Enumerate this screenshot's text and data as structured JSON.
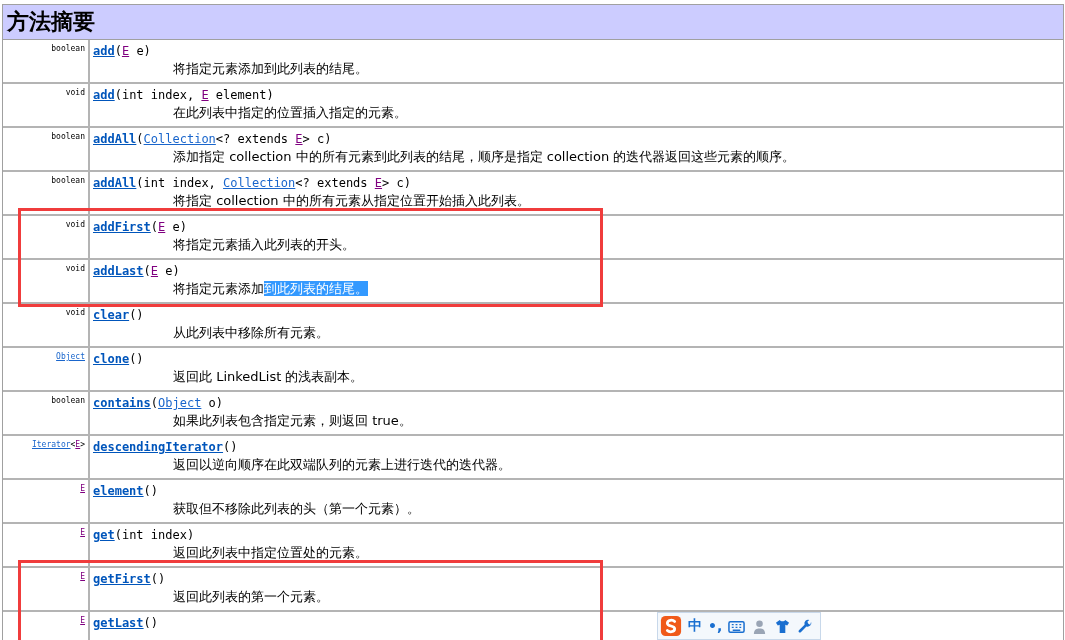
{
  "heading": "方法摘要",
  "rows": [
    {
      "return_type": [
        {
          "kind": "text",
          "text": "boolean"
        }
      ],
      "signature": [
        {
          "kind": "method",
          "text": "add"
        },
        {
          "kind": "text",
          "text": "("
        },
        {
          "kind": "type_param",
          "text": "E"
        },
        {
          "kind": "text",
          "text": " e)"
        }
      ],
      "description": "将指定元素添加到此列表的结尾。",
      "boxed": false
    },
    {
      "return_type": [
        {
          "kind": "text",
          "text": "void"
        }
      ],
      "signature": [
        {
          "kind": "method",
          "text": "add"
        },
        {
          "kind": "text",
          "text": "(int index, "
        },
        {
          "kind": "type_param",
          "text": "E"
        },
        {
          "kind": "text",
          "text": " element)"
        }
      ],
      "description": "在此列表中指定的位置插入指定的元素。",
      "boxed": false
    },
    {
      "return_type": [
        {
          "kind": "text",
          "text": "boolean"
        }
      ],
      "signature": [
        {
          "kind": "method",
          "text": "addAll"
        },
        {
          "kind": "text",
          "text": "("
        },
        {
          "kind": "type_link",
          "text": "Collection"
        },
        {
          "kind": "text",
          "text": "<? extends "
        },
        {
          "kind": "type_param",
          "text": "E"
        },
        {
          "kind": "text",
          "text": "> c)"
        }
      ],
      "description": "添加指定 collection 中的所有元素到此列表的结尾，顺序是指定 collection 的迭代器返回这些元素的顺序。",
      "boxed": false
    },
    {
      "return_type": [
        {
          "kind": "text",
          "text": "boolean"
        }
      ],
      "signature": [
        {
          "kind": "method",
          "text": "addAll"
        },
        {
          "kind": "text",
          "text": "(int index, "
        },
        {
          "kind": "type_link",
          "text": "Collection"
        },
        {
          "kind": "text",
          "text": "<? extends "
        },
        {
          "kind": "type_param",
          "text": "E"
        },
        {
          "kind": "text",
          "text": "> c)"
        }
      ],
      "description": "将指定 collection 中的所有元素从指定位置开始插入此列表。",
      "boxed": false
    },
    {
      "return_type": [
        {
          "kind": "text",
          "text": "void"
        }
      ],
      "signature": [
        {
          "kind": "method",
          "text": "addFirst"
        },
        {
          "kind": "text",
          "text": "("
        },
        {
          "kind": "type_param",
          "text": "E"
        },
        {
          "kind": "text",
          "text": " e)"
        }
      ],
      "description": "将指定元素插入此列表的开头。",
      "boxed": true
    },
    {
      "return_type": [
        {
          "kind": "text",
          "text": "void"
        }
      ],
      "signature": [
        {
          "kind": "method",
          "text": "addLast"
        },
        {
          "kind": "text",
          "text": "("
        },
        {
          "kind": "type_param",
          "text": "E"
        },
        {
          "kind": "text",
          "text": " e)"
        }
      ],
      "description": "将指定元素添加",
      "selected_text": "到此列表的结尾。",
      "boxed": true
    },
    {
      "return_type": [
        {
          "kind": "text",
          "text": "void"
        }
      ],
      "signature": [
        {
          "kind": "method",
          "text": "clear"
        },
        {
          "kind": "text",
          "text": "()"
        }
      ],
      "description": "从此列表中移除所有元素。",
      "boxed": false
    },
    {
      "return_type": [
        {
          "kind": "type_link",
          "text": "Object"
        }
      ],
      "signature": [
        {
          "kind": "method",
          "text": "clone"
        },
        {
          "kind": "text",
          "text": "()"
        }
      ],
      "description": "返回此 LinkedList 的浅表副本。",
      "boxed": false
    },
    {
      "return_type": [
        {
          "kind": "text",
          "text": "boolean"
        }
      ],
      "signature": [
        {
          "kind": "method",
          "text": "contains"
        },
        {
          "kind": "text",
          "text": "("
        },
        {
          "kind": "type_link",
          "text": "Object"
        },
        {
          "kind": "text",
          "text": " o)"
        }
      ],
      "description": "如果此列表包含指定元素，则返回 true。",
      "boxed": false
    },
    {
      "return_type": [
        {
          "kind": "type_link",
          "text": "Iterator"
        },
        {
          "kind": "text",
          "text": "<"
        },
        {
          "kind": "type_param",
          "text": "E"
        },
        {
          "kind": "text",
          "text": ">"
        }
      ],
      "signature": [
        {
          "kind": "method",
          "text": "descendingIterator"
        },
        {
          "kind": "text",
          "text": "()"
        }
      ],
      "description": "返回以逆向顺序在此双端队列的元素上进行迭代的迭代器。",
      "boxed": false
    },
    {
      "return_type": [
        {
          "kind": "type_param",
          "text": "E"
        }
      ],
      "signature": [
        {
          "kind": "method",
          "text": "element"
        },
        {
          "kind": "text",
          "text": "()"
        }
      ],
      "description": "获取但不移除此列表的头（第一个元素）。",
      "boxed": false
    },
    {
      "return_type": [
        {
          "kind": "type_param",
          "text": "E"
        }
      ],
      "signature": [
        {
          "kind": "method",
          "text": "get"
        },
        {
          "kind": "text",
          "text": "(int index)"
        }
      ],
      "description": "返回此列表中指定位置处的元素。",
      "boxed": false
    },
    {
      "return_type": [
        {
          "kind": "type_param",
          "text": "E"
        }
      ],
      "signature": [
        {
          "kind": "method",
          "text": "getFirst"
        },
        {
          "kind": "text",
          "text": "()"
        }
      ],
      "description": "返回此列表的第一个元素。",
      "boxed": true
    },
    {
      "return_type": [
        {
          "kind": "type_param",
          "text": "E"
        }
      ],
      "signature": [
        {
          "kind": "method",
          "text": "getLast"
        },
        {
          "kind": "text",
          "text": "()"
        }
      ],
      "boxed": true
    }
  ],
  "ime_toolbar": {
    "mode": "中",
    "punctuation": "•,"
  }
}
